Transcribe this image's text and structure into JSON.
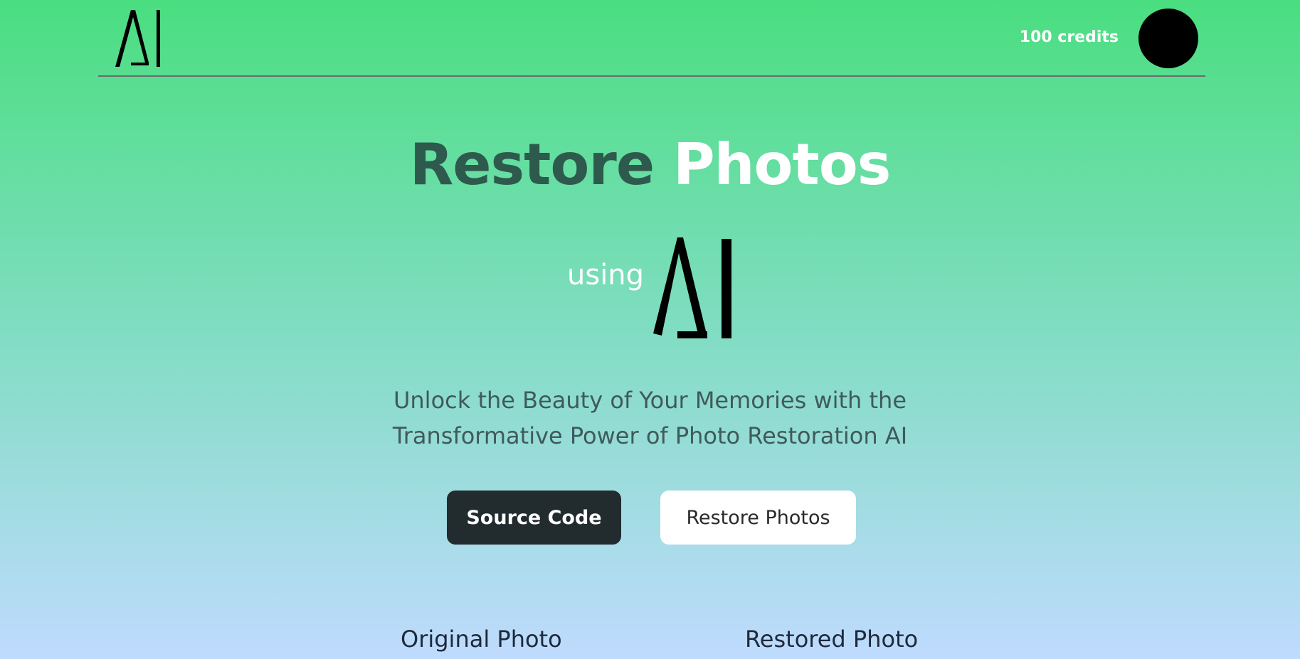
{
  "header": {
    "logo_icon": "ai-logo-icon",
    "credits": "100 credits",
    "avatar": "user-avatar"
  },
  "hero": {
    "title_part1": "Restore",
    "title_part2": "Photos",
    "using": "using",
    "ai_mark_icon": "ai-logo-icon",
    "subtitle_line1": "Unlock the Beauty of Your Memories with the",
    "subtitle_line2": "Transformative Power of Photo Restoration AI"
  },
  "buttons": {
    "source_code": "Source Code",
    "restore_photos": "Restore Photos"
  },
  "comparison": {
    "original_label": "Original Photo",
    "restored_label": "Restored Photo"
  },
  "colors": {
    "gradient_top": "#4ade80",
    "gradient_bottom": "#bfdbfe",
    "title_dark": "#2e5a4d",
    "button_dark": "#222b2d"
  }
}
